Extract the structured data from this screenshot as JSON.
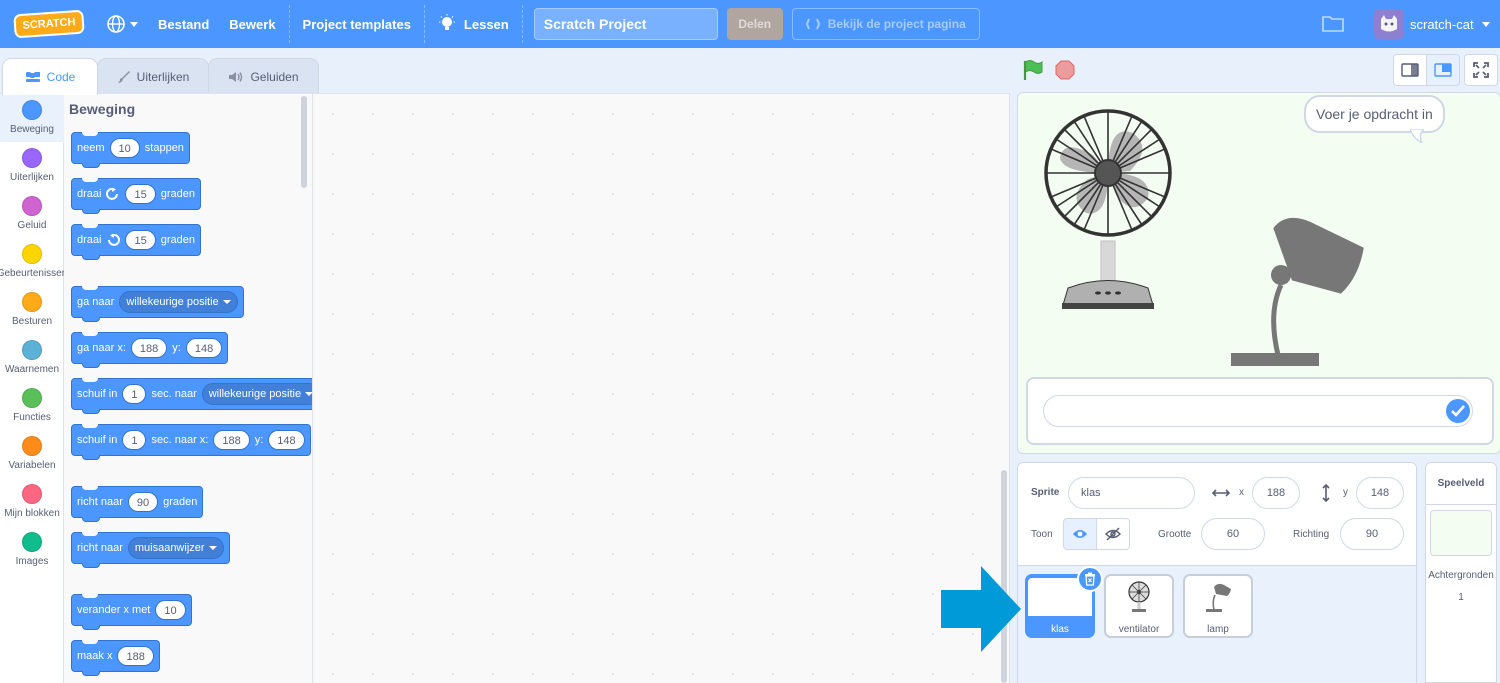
{
  "menubar": {
    "logo": "SCRATCH",
    "file": "Bestand",
    "edit": "Bewerk",
    "templates": "Project templates",
    "tutorials": "Lessen",
    "project_title": "Scratch Project",
    "share": "Delen",
    "see_project_page": "Bekijk de project pagina",
    "username": "scratch-cat"
  },
  "tabs": [
    {
      "label": "Code",
      "icon": "code-icon"
    },
    {
      "label": "Uiterlijken",
      "icon": "costume-brush-icon"
    },
    {
      "label": "Geluiden",
      "icon": "speaker-icon"
    }
  ],
  "categories": [
    {
      "label": "Beweging",
      "color": "#4c97ff"
    },
    {
      "label": "Uiterlijken",
      "color": "#9966ff"
    },
    {
      "label": "Geluid",
      "color": "#cf63cf"
    },
    {
      "label": "Gebeurtenissen",
      "color": "#ffd500"
    },
    {
      "label": "Besturen",
      "color": "#ffab19"
    },
    {
      "label": "Waarnemen",
      "color": "#5cb1d6"
    },
    {
      "label": "Functies",
      "color": "#59c059"
    },
    {
      "label": "Variabelen",
      "color": "#ff8c1a"
    },
    {
      "label": "Mijn blokken",
      "color": "#ff6680"
    },
    {
      "label": "Images",
      "color": "#0fbd8c"
    }
  ],
  "palette": {
    "section_title": "Beweging",
    "blocks": {
      "move": {
        "pre": "neem",
        "value": "10",
        "post": "stappen"
      },
      "turn_right": {
        "pre": "draai",
        "value": "15",
        "post": "graden"
      },
      "turn_left": {
        "pre": "draai",
        "value": "15",
        "post": "graden"
      },
      "goto": {
        "pre": "ga naar",
        "dropdown": "willekeurige positie"
      },
      "goto_xy": {
        "pre": "ga naar x:",
        "x": "188",
        "ylabel": "y:",
        "y": "148"
      },
      "glide": {
        "pre": "schuif in",
        "secs": "1",
        "mid": "sec. naar",
        "dropdown": "willekeurige positie"
      },
      "glide_xy": {
        "pre": "schuif in",
        "secs": "1",
        "mid": "sec. naar x:",
        "x": "188",
        "ylabel": "y:",
        "y": "148"
      },
      "point_dir": {
        "pre": "richt naar",
        "value": "90",
        "post": "graden"
      },
      "point_towards": {
        "pre": "richt naar",
        "dropdown": "muisaanwijzer"
      },
      "change_x": {
        "pre": "verander x met",
        "value": "10"
      },
      "set_x": {
        "pre": "maak x",
        "value": "188"
      }
    }
  },
  "stage": {
    "speech": "Voer je opdracht in",
    "ask_value": ""
  },
  "sprite_info": {
    "sprite_label": "Sprite",
    "sprite_name": "klas",
    "x_label": "x",
    "x": "188",
    "y_label": "y",
    "y": "148",
    "show_label": "Toon",
    "size_label": "Grootte",
    "size": "60",
    "direction_label": "Richting",
    "direction": "90"
  },
  "sprites": [
    {
      "name": "klas",
      "selected": true
    },
    {
      "name": "ventilator",
      "selected": false
    },
    {
      "name": "lamp",
      "selected": false
    }
  ],
  "stage_target": {
    "title": "Speelveld",
    "backdrops_label": "Achtergronden",
    "backdrops_count": "1"
  },
  "colors": {
    "accent": "#4c97ff",
    "menubar": "#4c97ff",
    "arrow": "#009ad8"
  }
}
